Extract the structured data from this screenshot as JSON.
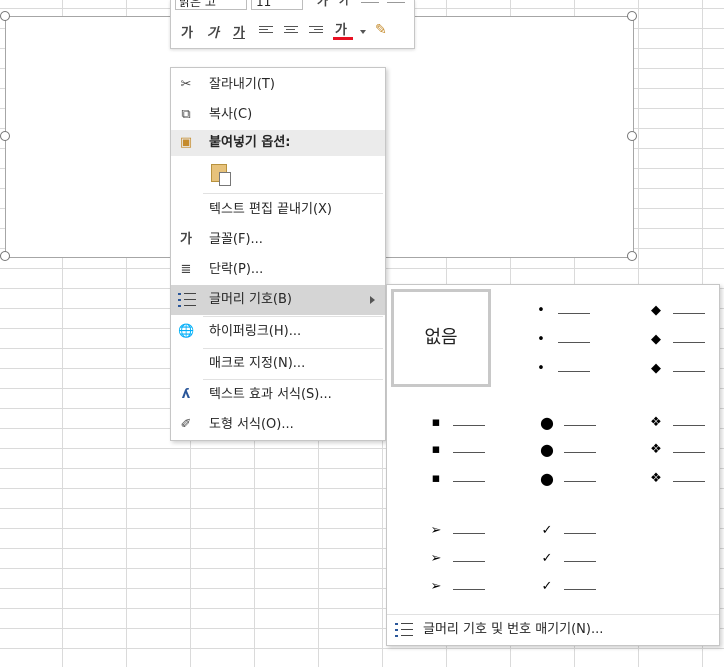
{
  "mini_toolbar": {
    "font_name": "맑은 고",
    "font_size": "11",
    "bold": "가",
    "italic": "가",
    "underline": "가",
    "font_color_glyph": "가",
    "font_color": "#e81123"
  },
  "context_menu": {
    "items": [
      {
        "label": "잘라내기(T)",
        "icon": "scissors-icon"
      },
      {
        "label": "복사(C)",
        "icon": "copy-icon"
      },
      {
        "label": "붙여넣기 옵션:",
        "icon": "paste-icon"
      },
      {
        "label": "",
        "icon": "paste-keep-text-icon"
      },
      {
        "label": "텍스트 편집 끝내기(X)",
        "icon": ""
      },
      {
        "label": "글꼴(F)...",
        "icon": "font-icon",
        "glyph": "가"
      },
      {
        "label": "단락(P)...",
        "icon": "paragraph-icon"
      },
      {
        "label": "글머리 기호(B)",
        "icon": "bullets-icon"
      },
      {
        "label": "하이퍼링크(H)...",
        "icon": "hyperlink-icon"
      },
      {
        "label": "매크로 지정(N)...",
        "icon": ""
      },
      {
        "label": "텍스트 효과 서식(S)...",
        "icon": "text-effects-icon"
      },
      {
        "label": "도형 서식(O)...",
        "icon": "format-shape-icon"
      }
    ]
  },
  "bullet_gallery": {
    "none_label": "없음",
    "symbols": [
      "•",
      "◆",
      "▪",
      "●",
      "❖",
      "➢",
      "✓"
    ],
    "footer_label": "글머리 기호 및 번호 매기기(N)..."
  },
  "colors": {
    "accent": "#2b579a",
    "highlight": "#d5d5d5"
  }
}
